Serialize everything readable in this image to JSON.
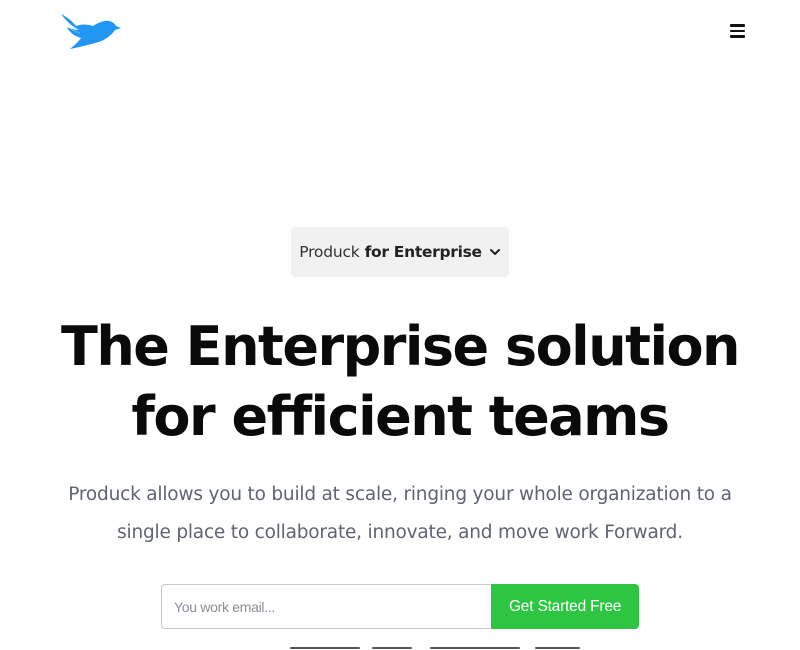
{
  "header": {
    "logo_icon": "bird-logo-icon",
    "logo_color": "#2196f3",
    "menu_icon": "hamburger-menu-icon"
  },
  "product_selector": {
    "prefix": "Produck",
    "emphasis": "for Enterprise",
    "icon": "chevron-down-icon"
  },
  "hero": {
    "title_line1": "The Enterprise solution",
    "title_line2": "for efficient teams",
    "description_line1": "Produck allows you to build at scale, ringing your whole organization to a",
    "description_line2": "single place to collaborate, innovate, and move work Forward."
  },
  "signup": {
    "email_placeholder": "You work email...",
    "email_value": "",
    "cta_label": "Get Started Free",
    "cta_color": "#2ec542"
  }
}
